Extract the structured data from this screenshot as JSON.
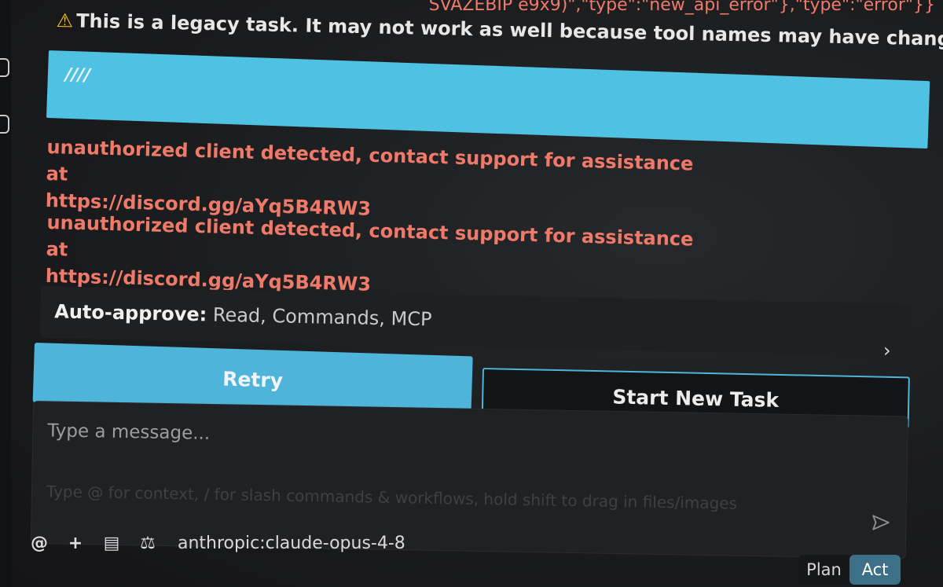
{
  "error_json_fragment": "SVAZEBIP e9x9)\",\"type\":\"new_api_error\"},\"type\":\"error\"}}",
  "legacy_warning": {
    "icon": "warning-triangle-icon",
    "text": "This is a legacy task. It may not work as well because tool names may have changed."
  },
  "user_message": {
    "text": "////",
    "background": "#4fc1e3"
  },
  "errors": [
    {
      "line1": "unauthorized client detected, contact support for assistance at",
      "line2": "https://discord.gg/aYq5B4RW3"
    },
    {
      "line1": "unauthorized client detected, contact support for assistance at",
      "line2": "https://discord.gg/aYq5B4RW3"
    }
  ],
  "auto_approve": {
    "label": "Auto-approve:",
    "values": "Read, Commands, MCP",
    "expand_icon": "chevron-right-icon"
  },
  "actions": {
    "retry_label": "Retry",
    "new_task_label": "Start New Task"
  },
  "input": {
    "placeholder": "Type a message...",
    "hint": "Type @ for context, / for slash commands & workflows, hold shift to drag in files/images",
    "send_icon": "send-icon"
  },
  "footer": {
    "mention_icon": "at-icon",
    "add_icon": "plus-icon",
    "rules_icon": "rules-icon",
    "model_icon": "scale-icon",
    "model": "anthropic:claude-opus-4-8"
  },
  "mode": {
    "plan_label": "Plan",
    "act_label": "Act",
    "active": "Act"
  },
  "colors": {
    "accent": "#4fb4da",
    "error": "#f07a6a",
    "warning": "#f4c227",
    "background": "#1b1c1e"
  }
}
